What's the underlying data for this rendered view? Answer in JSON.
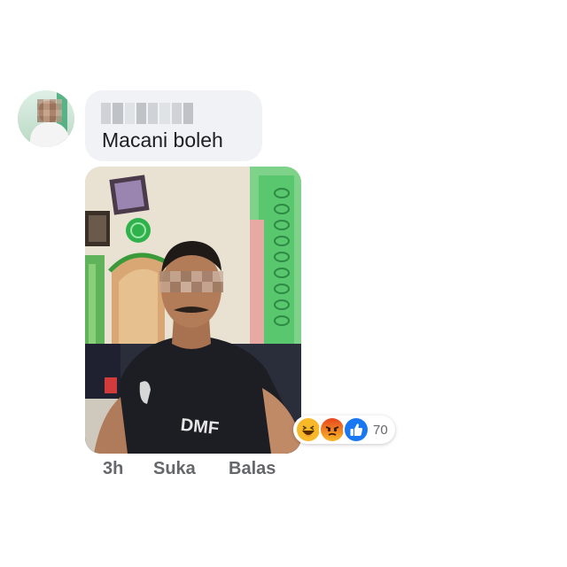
{
  "comment": {
    "author_name": "",
    "text": "Macani boleh",
    "reactions": {
      "icons": [
        "haha-icon",
        "angry-icon",
        "like-icon"
      ],
      "count": "70"
    },
    "actions": {
      "time": "3h",
      "like": "Suka",
      "reply": "Balas"
    }
  },
  "colors": {
    "bubble_bg": "#f0f2f5",
    "text": "#1c1e21",
    "meta_text": "#65676b",
    "like_blue": "#1877f2",
    "haha_yellow": "#f7b928",
    "angry_orange": "#e9710f"
  },
  "photo": {
    "shirt_text": "DMF"
  }
}
